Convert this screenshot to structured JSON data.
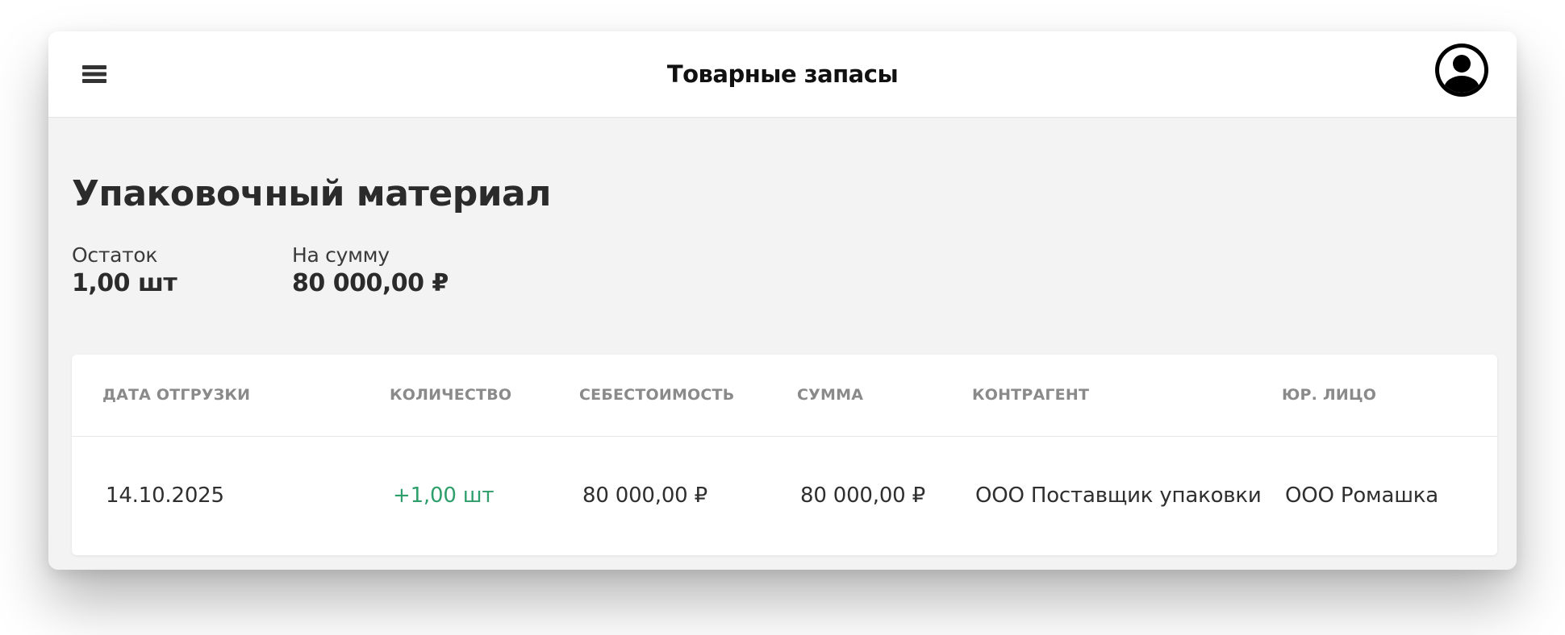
{
  "header": {
    "title": "Товарные запасы",
    "menu_icon": "hamburger-menu-icon",
    "avatar_icon": "user-account-icon"
  },
  "item": {
    "title": "Упаковочный материал",
    "stats": [
      {
        "label": "Остаток",
        "value": "1,00 шт"
      },
      {
        "label": "На сумму",
        "value": "80 000,00 ₽"
      }
    ]
  },
  "table": {
    "columns": [
      "ДАТА ОТГРУЗКИ",
      "КОЛИЧЕСТВО",
      "СЕБЕСТОИМОСТЬ",
      "СУММА",
      "КОНТРАГЕНТ",
      "ЮР. ЛИЦО"
    ],
    "rows": [
      {
        "date": "14.10.2025",
        "quantity": "+1,00 шт",
        "cost": "80 000,00 ₽",
        "sum": "80 000,00 ₽",
        "counterparty": "ООО Поставщик упаковки",
        "legal_entity": "ООО Ромашка"
      }
    ]
  },
  "colors": {
    "accent_positive": "#2e9e6b",
    "header_text": "#111111",
    "background": "#f3f3f3"
  }
}
